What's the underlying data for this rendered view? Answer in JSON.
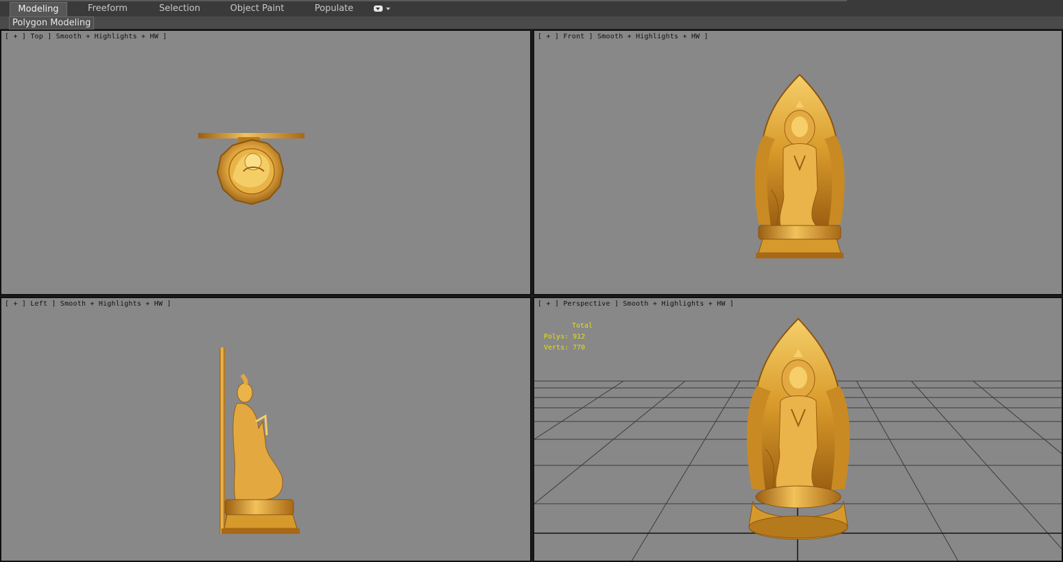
{
  "ribbon": {
    "tabs": [
      {
        "label": "Modeling",
        "active": true
      },
      {
        "label": "Freeform",
        "active": false
      },
      {
        "label": "Selection",
        "active": false
      },
      {
        "label": "Object Paint",
        "active": false
      },
      {
        "label": "Populate",
        "active": false
      }
    ],
    "options_icon": "dropdown-chip-icon",
    "panel_label": "Polygon Modeling"
  },
  "viewports": {
    "top": {
      "label": "[ + ] Top ] Smooth + Highlights + HW ]"
    },
    "front": {
      "label": "[ + ] Front ] Smooth + Highlights + HW ]"
    },
    "left": {
      "label": "[ + ] Left ] Smooth + Highlights + HW ]"
    },
    "perspective": {
      "label": "[ + ] Perspective ] Smooth + Highlights + HW ]",
      "stats": {
        "header": "Total",
        "polys": "Polys: 912",
        "verts": "Verts: 770"
      }
    }
  },
  "colors": {
    "viewport_bg": "#888888",
    "gold_light": "#f3c25a",
    "gold_mid": "#d69a2c",
    "gold_dark": "#8a5410",
    "stats_text": "#e8e000",
    "grid_line": "#3a3a3a"
  }
}
